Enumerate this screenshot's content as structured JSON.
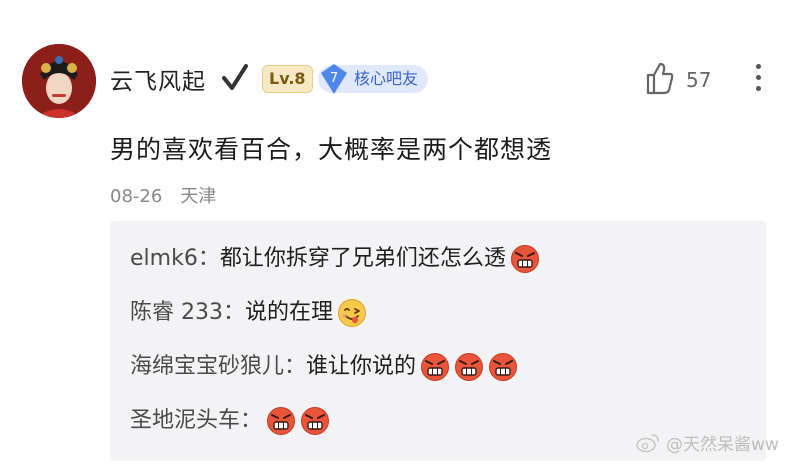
{
  "post": {
    "username": "云飞风起",
    "level_badge": "Lv.8",
    "fan_badge": {
      "level": "7",
      "label": "核心吧友"
    },
    "likes": "57",
    "content": "男的喜欢看百合，大概率是两个都想透",
    "date": "08-26",
    "location": "天津"
  },
  "replies": [
    {
      "name": "elmk6：",
      "text": "都让你拆穿了兄弟们还怎么透",
      "emoji": [
        "angry-face-icon"
      ]
    },
    {
      "name": "陈睿 233：",
      "text": "说的在理",
      "emoji": [
        "yummy-face-icon"
      ]
    },
    {
      "name": "海绵宝宝砂狼儿：",
      "text": "谁让你说的",
      "emoji": [
        "angry-face-icon",
        "angry-face-icon",
        "angry-face-icon"
      ]
    },
    {
      "name": "圣地泥头车：",
      "text": "",
      "emoji": [
        "angry-face-icon",
        "angry-face-icon"
      ]
    }
  ],
  "watermark": "@天然呆酱ww",
  "colors": {
    "angry_emoji": "#e8553a",
    "fan_badge_bg": "#dfe9fb",
    "reply_panel_bg": "#f3f3f5"
  }
}
